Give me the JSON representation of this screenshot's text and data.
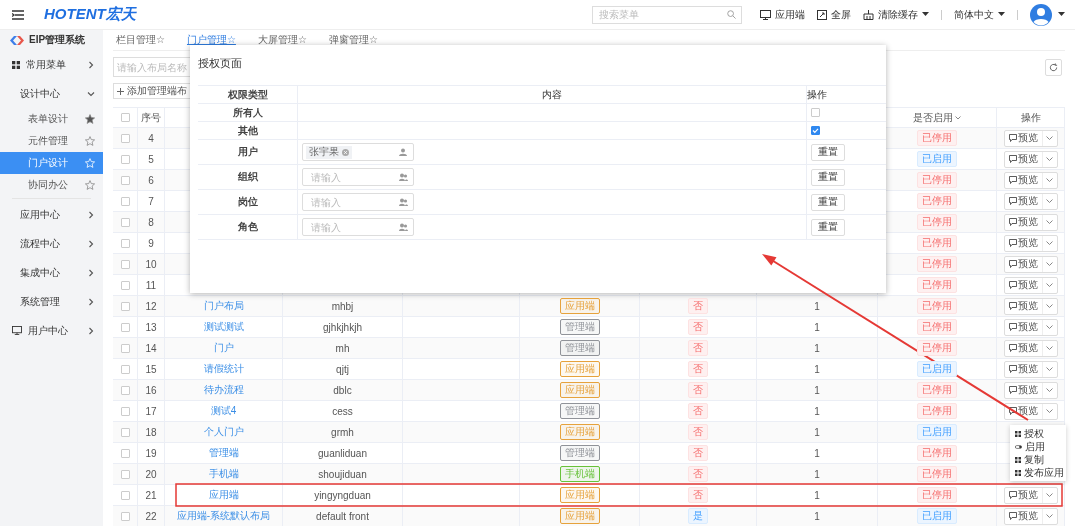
{
  "header": {
    "logo": "HOTENT宏天",
    "search_placeholder": "搜索菜单",
    "links": [
      {
        "label": "应用端",
        "kind": "monitor",
        "dropdown": false
      },
      {
        "label": "全屏",
        "kind": "expand",
        "dropdown": false
      },
      {
        "label": "清除缓存",
        "kind": "broom",
        "dropdown": true
      }
    ],
    "language": "简体中文"
  },
  "sidebar": {
    "title": "EIP管理系统",
    "items": [
      {
        "label": "常用菜单",
        "expanded": false
      },
      {
        "label": "设计中心",
        "expanded": true,
        "children": [
          {
            "label": "表单设计",
            "selected": false,
            "starred": true
          },
          {
            "label": "元件管理",
            "selected": false,
            "starred": false
          },
          {
            "label": "门户设计",
            "selected": true,
            "starred": false
          },
          {
            "label": "协同办公",
            "selected": false,
            "starred": false
          }
        ]
      },
      {
        "label": "应用中心",
        "expanded": false
      },
      {
        "label": "流程中心",
        "expanded": false
      },
      {
        "label": "集成中心",
        "expanded": false
      },
      {
        "label": "系统管理",
        "expanded": false
      },
      {
        "label": "用户中心",
        "expanded": false
      }
    ]
  },
  "tabs": [
    {
      "label": "栏目管理☆",
      "selected": false
    },
    {
      "label": "门户管理☆",
      "selected": true
    },
    {
      "label": "大屏管理☆",
      "selected": false
    },
    {
      "label": "弹窗管理☆",
      "selected": false
    }
  ],
  "toolbar": {
    "search_placeholder": "请输入布局名称",
    "add_button": "添加管理端布"
  },
  "table": {
    "headers": {
      "index": "序号",
      "status": "是否启用",
      "action": "操作"
    },
    "all_checked": false,
    "rows": [
      {
        "index": "4",
        "checked": false,
        "status": "已停用",
        "enabled": false,
        "action": "预览"
      },
      {
        "index": "5",
        "checked": false,
        "status": "已启用",
        "enabled": true,
        "action": "预览"
      },
      {
        "index": "6",
        "checked": false,
        "status": "已停用",
        "enabled": false,
        "action": "预览"
      },
      {
        "index": "7",
        "checked": false,
        "status": "已停用",
        "enabled": false,
        "action": "预览"
      },
      {
        "index": "8",
        "checked": false,
        "status": "已停用",
        "enabled": false,
        "action": "预览"
      },
      {
        "index": "9",
        "checked": false,
        "status": "已停用",
        "enabled": false,
        "action": "预览"
      },
      {
        "index": "10",
        "checked": false,
        "status": "已停用",
        "enabled": false,
        "action": "预览"
      },
      {
        "index": "11",
        "checked": false,
        "status": "已停用",
        "enabled": false,
        "action": "预览"
      },
      {
        "index": "12",
        "checked": false,
        "name": "门户布局",
        "alias": "mhbj",
        "type": "应用端",
        "color": "#e6a23c",
        "default": "否",
        "is_default": false,
        "count": "1",
        "status": "已停用",
        "enabled": false,
        "action": "预览"
      },
      {
        "index": "13",
        "checked": false,
        "name": "测试测试",
        "alias": "gjhkjhkjh",
        "type": "管理端",
        "color": "#909399",
        "default": "否",
        "is_default": false,
        "count": "1",
        "status": "已停用",
        "enabled": false,
        "action": "预览"
      },
      {
        "index": "14",
        "checked": false,
        "name": "门户",
        "alias": "mh",
        "type": "管理端",
        "color": "#909399",
        "default": "否",
        "is_default": false,
        "count": "1",
        "status": "已停用",
        "enabled": false,
        "action": "预览"
      },
      {
        "index": "15",
        "checked": false,
        "name": "请假统计",
        "alias": "qjtj",
        "type": "应用端",
        "color": "#e6a23c",
        "default": "否",
        "is_default": false,
        "count": "1",
        "status": "已启用",
        "enabled": true,
        "action": "预览"
      },
      {
        "index": "16",
        "checked": false,
        "name": "待办流程",
        "alias": "dblc",
        "type": "应用端",
        "color": "#e6a23c",
        "default": "否",
        "is_default": false,
        "count": "1",
        "status": "已停用",
        "enabled": false,
        "action": "预览"
      },
      {
        "index": "17",
        "checked": false,
        "name": "测试4",
        "alias": "cess",
        "type": "管理端",
        "color": "#909399",
        "default": "否",
        "is_default": false,
        "count": "1",
        "status": "已停用",
        "enabled": false,
        "action": "预览"
      },
      {
        "index": "18",
        "checked": false,
        "name": "个人门户",
        "alias": "grmh",
        "type": "应用端",
        "color": "#e6a23c",
        "default": "否",
        "is_default": false,
        "count": "1",
        "status": "已启用",
        "enabled": true
      },
      {
        "index": "19",
        "checked": false,
        "name": "管理端",
        "alias": "guanliduan",
        "type": "管理端",
        "color": "#909399",
        "default": "否",
        "is_default": false,
        "count": "1",
        "status": "已停用",
        "enabled": false
      },
      {
        "index": "20",
        "checked": false,
        "name": "手机端",
        "alias": "shoujiduan",
        "type": "手机端",
        "color": "#67c23a",
        "default": "否",
        "is_default": false,
        "count": "1",
        "status": "已停用",
        "enabled": false
      },
      {
        "index": "21",
        "checked": false,
        "name": "应用端",
        "alias": "yingyngduan",
        "type": "应用端",
        "color": "#e6a23c",
        "default": "否",
        "is_default": false,
        "count": "1",
        "status": "已停用",
        "enabled": false,
        "action": "预览"
      },
      {
        "index": "22",
        "checked": false,
        "name": "应用端-系统默认布局",
        "alias": "default front",
        "type": "应用端",
        "color": "#e6a23c",
        "default": "是",
        "is_default": true,
        "count": "1",
        "status": "已启用",
        "enabled": true,
        "action": "预览"
      }
    ]
  },
  "dialog": {
    "title": "授权页面",
    "columns": [
      "权限类型",
      "内容",
      "操作"
    ],
    "rows": [
      {
        "label": "所有人",
        "kind": "checkbox",
        "checked": false
      },
      {
        "label": "其他",
        "kind": "checkbox",
        "checked": true
      },
      {
        "label": "用户",
        "kind": "picker",
        "tags": [
          "张宇果"
        ],
        "button": "重置"
      },
      {
        "label": "组织",
        "kind": "picker",
        "placeholder": "请输入",
        "button": "重置"
      },
      {
        "label": "岗位",
        "kind": "picker",
        "placeholder": "请输入",
        "button": "重置"
      },
      {
        "label": "角色",
        "kind": "picker",
        "placeholder": "请输入",
        "button": "重置"
      }
    ]
  },
  "dropdown_menu": {
    "items": [
      {
        "label": "授权"
      },
      {
        "label": "启用"
      },
      {
        "label": "复制"
      },
      {
        "label": "发布应用"
      }
    ]
  }
}
